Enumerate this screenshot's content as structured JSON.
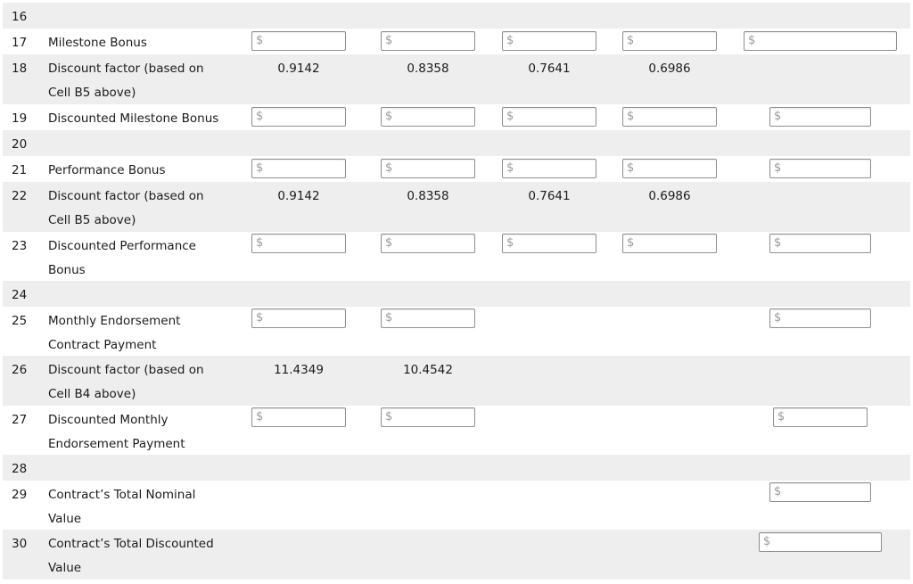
{
  "currency_symbol": "$",
  "rows": [
    {
      "num": "16",
      "label": ""
    },
    {
      "num": "17",
      "label": "Milestone Bonus"
    },
    {
      "num": "18",
      "label": "Discount factor (based on Cell B5 above)",
      "values": [
        "0.9142",
        "0.8358",
        "0.7641",
        "0.6986"
      ]
    },
    {
      "num": "19",
      "label": "Discounted Milestone Bonus"
    },
    {
      "num": "20",
      "label": ""
    },
    {
      "num": "21",
      "label": "Performance Bonus"
    },
    {
      "num": "22",
      "label": "Discount factor (based on Cell B5 above)",
      "values": [
        "0.9142",
        "0.8358",
        "0.7641",
        "0.6986"
      ]
    },
    {
      "num": "23",
      "label": "Discounted Performance Bonus"
    },
    {
      "num": "24",
      "label": ""
    },
    {
      "num": "25",
      "label": "Monthly Endorsement Contract Payment"
    },
    {
      "num": "26",
      "label": "Discount factor (based on Cell B4 above)",
      "values": [
        "11.4349",
        "10.4542"
      ]
    },
    {
      "num": "27",
      "label": "Discounted Monthly Endorsement Payment"
    },
    {
      "num": "28",
      "label": ""
    },
    {
      "num": "29",
      "label": "Contract’s Total Nominal Value"
    },
    {
      "num": "30",
      "label": "Contract’s Total Discounted Value"
    }
  ]
}
